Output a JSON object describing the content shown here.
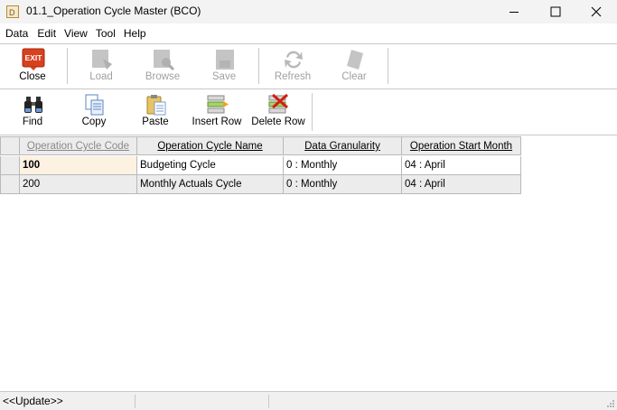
{
  "window": {
    "title": "01.1_Operation Cycle Master (BCO)"
  },
  "menu": [
    "Data",
    "Edit",
    "View",
    "Tool",
    "Help"
  ],
  "toolbar1": [
    {
      "label": "Close",
      "icon": "exit-icon",
      "enabled": true
    },
    {
      "label": "Load",
      "icon": "load-icon",
      "enabled": false
    },
    {
      "label": "Browse",
      "icon": "browse-icon",
      "enabled": false
    },
    {
      "label": "Save",
      "icon": "save-icon",
      "enabled": false
    },
    {
      "label": "Refresh",
      "icon": "refresh-icon",
      "enabled": false
    },
    {
      "label": "Clear",
      "icon": "clear-icon",
      "enabled": false
    }
  ],
  "toolbar2": [
    {
      "label": "Find",
      "icon": "binoculars-icon",
      "enabled": true
    },
    {
      "label": "Copy",
      "icon": "copy-icon",
      "enabled": true
    },
    {
      "label": "Paste",
      "icon": "paste-icon",
      "enabled": true
    },
    {
      "label": "Insert Row",
      "icon": "insert-row-icon",
      "enabled": true
    },
    {
      "label": "Delete Row",
      "icon": "delete-row-icon",
      "enabled": true
    }
  ],
  "exit_icon_text": "EXIT",
  "grid": {
    "columns": [
      "Operation Cycle Code",
      "Operation Cycle Name",
      "Data Granularity",
      "Operation Start Month"
    ],
    "rows": [
      [
        "100",
        "Budgeting Cycle",
        "0 : Monthly",
        "04 : April"
      ],
      [
        "200",
        "Monthly Actuals Cycle",
        "0 : Monthly",
        "04 : April"
      ]
    ]
  },
  "status": {
    "mode": "<<Update>>"
  },
  "colors": {
    "exit": "#d9401e",
    "code_cell": "#fdf1e2",
    "grid_header": "#ececec"
  }
}
